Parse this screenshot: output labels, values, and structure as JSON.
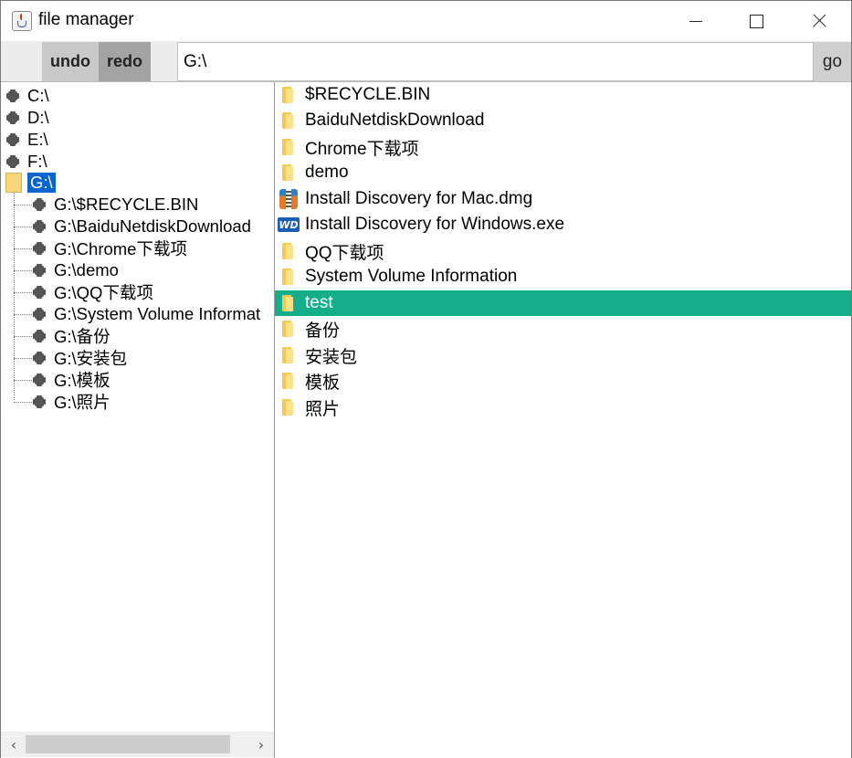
{
  "window": {
    "title": "file manager"
  },
  "toolbar": {
    "undo_label": "undo",
    "redo_label": "redo",
    "path_value": "G:\\",
    "go_label": "go"
  },
  "tree": {
    "roots": [
      "C:\\",
      "D:\\",
      "E:\\",
      "F:\\"
    ],
    "expanded_root": "G:\\",
    "children": [
      "G:\\$RECYCLE.BIN",
      "G:\\BaiduNetdiskDownload",
      "G:\\Chrome下载项",
      "G:\\demo",
      "G:\\QQ下载项",
      "G:\\System Volume Informat",
      "G:\\备份",
      "G:\\安装包",
      "G:\\模板",
      "G:\\照片"
    ]
  },
  "files": [
    {
      "name": "$RECYCLE.BIN",
      "icon": "folder-icon"
    },
    {
      "name": "BaiduNetdiskDownload",
      "icon": "folder-icon"
    },
    {
      "name": "Chrome下载项",
      "icon": "folder-icon"
    },
    {
      "name": "demo",
      "icon": "folder-icon"
    },
    {
      "name": "Install Discovery for Mac.dmg",
      "icon": "archive-icon"
    },
    {
      "name": "Install Discovery for Windows.exe",
      "icon": "wd-app-icon"
    },
    {
      "name": "QQ下载项",
      "icon": "folder-icon"
    },
    {
      "name": "System Volume Information",
      "icon": "folder-icon"
    },
    {
      "name": "test",
      "icon": "folder-icon",
      "selected": true
    },
    {
      "name": "备份",
      "icon": "folder-icon"
    },
    {
      "name": "安装包",
      "icon": "folder-icon"
    },
    {
      "name": "模板",
      "icon": "folder-icon"
    },
    {
      "name": "照片",
      "icon": "folder-icon"
    }
  ],
  "colors": {
    "selection_row": "#14ae8a",
    "tree_selection": "#0a64d0",
    "redo_button": "#a3a3a3",
    "undo_button": "#c9c9c9"
  }
}
